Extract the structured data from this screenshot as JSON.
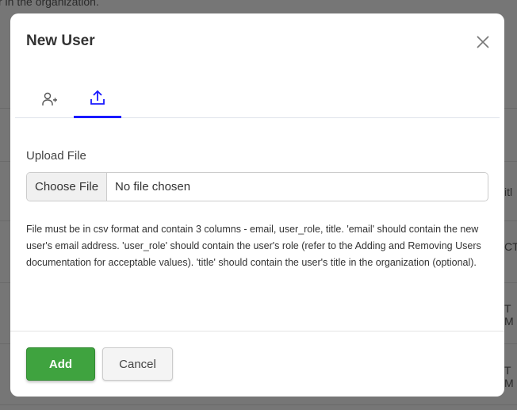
{
  "background": {
    "fragments": [
      "r in the organization.",
      "itl",
      "CTO",
      "T M",
      "T M"
    ]
  },
  "modal": {
    "title": "New User",
    "close_icon": "close-icon",
    "tabs": [
      {
        "icon": "user-plus-icon",
        "active": false
      },
      {
        "icon": "upload-icon",
        "active": true
      }
    ],
    "accent": "#1a1aff",
    "upload_label": "Upload File",
    "choose_file": "Choose File",
    "no_file": "No file chosen",
    "help": "File must be in csv format and contain 3 columns - email, user_role, title. 'email' should contain the new user's email address. 'user_role' should contain the user's role (refer to the Adding and Removing Users documentation for acceptable values). 'title' should contain the user's title in the organization (optional).",
    "add_label": "Add",
    "cancel_label": "Cancel",
    "add_color": "#3fa33f"
  }
}
